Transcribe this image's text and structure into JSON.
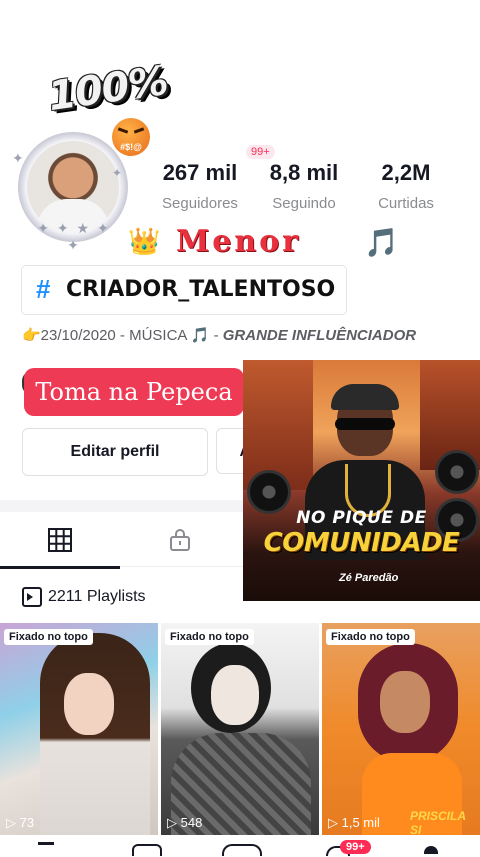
{
  "badge": {
    "text": "100%",
    "emoji_text": "#$!@"
  },
  "stats": [
    {
      "value": "267 mil",
      "label": "Seguidores"
    },
    {
      "value": "8,8 mil",
      "label": "Seguindo"
    },
    {
      "value": "2,2M",
      "label": "Curtidas"
    }
  ],
  "notif_count": "99+",
  "name_line": {
    "crown": "👑",
    "name": "Menor",
    "note": "🎵"
  },
  "hashtag": {
    "symbol": "#",
    "text": "CRIADOR_TALENTOSO"
  },
  "bio": {
    "prefix": "👉23/10/2020 - MÚSICA 🎵 - ",
    "highlight": "GRANDE INFLUÊNCIADOR"
  },
  "link_button": "Toma na Pepeca",
  "edit_button": "Editar perfil",
  "edit_button_2": "A",
  "playlists": "2211 Playlists",
  "album": {
    "line1": "NO PIQUE DE",
    "line2": "COMUNIDADE",
    "line3": "Zé Paredão"
  },
  "videos": [
    {
      "pinned": "Fixado no topo",
      "views": "73"
    },
    {
      "pinned": "Fixado no topo",
      "views": "548"
    },
    {
      "pinned": "Fixado no topo",
      "views": "1,5 mil",
      "overlay": "PRISCILA SI"
    }
  ],
  "nav_badge": "99+",
  "colors": {
    "accent": "#fe2c55",
    "tag_blue": "#1e90ff",
    "gold": "#f8d23a"
  }
}
